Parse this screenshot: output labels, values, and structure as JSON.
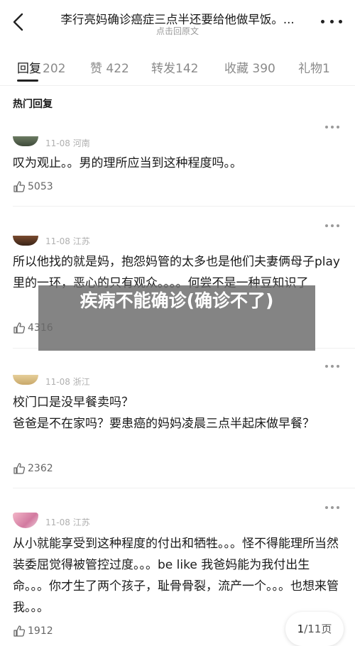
{
  "header": {
    "title": "李行亮妈确诊癌症三点半还要给他做早饭。...",
    "subtitle": "点击回原文"
  },
  "tabs": [
    {
      "label": "回复",
      "count": "202",
      "active": true
    },
    {
      "label": "赞",
      "count": "422",
      "active": false
    },
    {
      "label": "转发",
      "count": "142",
      "active": false
    },
    {
      "label": "收藏",
      "count": "390",
      "active": false
    },
    {
      "label": "礼物",
      "count": "1",
      "active": false
    }
  ],
  "section_title": "热门回复",
  "comments": [
    {
      "date": "11-08",
      "location": "河南",
      "text": "叹为观止。。男的理所应当到这种程度吗。。",
      "likes": "5053"
    },
    {
      "date": "11-08",
      "location": "江苏",
      "text": "所以他找的就是妈，抱怨妈管的太多也是他们夫妻俩母子play里的一环，恶心的只有观众。。。。何尝不是一种豆知识了",
      "likes": "4316"
    },
    {
      "date": "11-08",
      "location": "浙江",
      "text": "校门口是没早餐卖吗？\n爸爸是不在家吗？要患癌的妈妈凌晨三点半起床做早餐？",
      "likes": "2362"
    },
    {
      "date": "11-08",
      "location": "江苏",
      "text": "从小就能享受到这种程度的付出和牺牲。。。怪不得能理所当然装委屈觉得被管控过度。。。be like 我爸妈能为我付出生命。。。你才生了两个孩子，耻骨骨裂，流产一个。。。也想来管我。。。",
      "likes": "1912"
    }
  ],
  "overlay": {
    "text": "疾病不能确诊(确诊不了)"
  },
  "pager": {
    "current": "1",
    "total": "/11页"
  },
  "colors": {
    "accent": "#1a1a1a",
    "muted": "#9a9a9a",
    "overlay": "#696969"
  }
}
